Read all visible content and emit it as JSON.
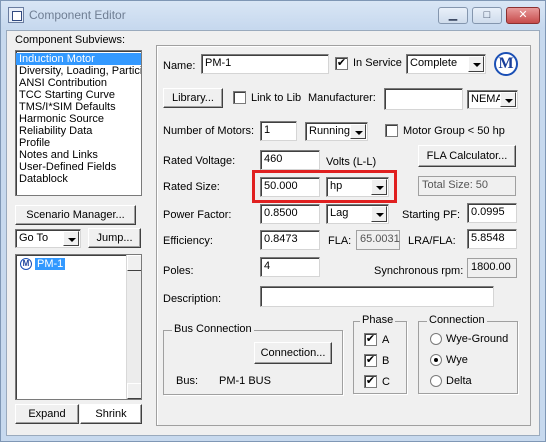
{
  "window": {
    "title": "Component Editor",
    "min_label": "▁",
    "max_label": "□",
    "close_label": "✕",
    "close_color": "#c74b4b"
  },
  "left": {
    "subviews_label": "Component Subviews:",
    "subviews": [
      "Induction Motor",
      "Diversity, Loading, Particip",
      "ANSI Contribution",
      "TCC Starting Curve",
      "TMS/I*SIM Defaults",
      "Harmonic Source",
      "Reliability Data",
      "Profile",
      "Notes and Links",
      "User-Defined Fields",
      "Datablock"
    ],
    "selected_subview": 0,
    "scenario_button": "Scenario Manager...",
    "goto_value": "Go To",
    "jump_button": "Jump...",
    "tree_item": "PM-1",
    "expand_button": "Expand",
    "shrink_button": "Shrink"
  },
  "form": {
    "name_label": "Name:",
    "name_value": "PM-1",
    "in_service_label": "In Service",
    "in_service_checked": "✔",
    "status_value": "Complete",
    "library_button": "Library...",
    "link_to_lib_label": "Link to Lib",
    "manufacturer_label": "Manufacturer:",
    "manufacturer_value": "",
    "standard_value": "NEMA",
    "num_motors_label": "Number of Motors:",
    "num_motors_value": "1",
    "running_value": "Running",
    "motor_group_label": "Motor Group < 50 hp",
    "rated_voltage_label": "Rated Voltage:",
    "rated_voltage_value": "460",
    "volts_unit": "Volts (L-L)",
    "fla_calc_button": "FLA Calculator...",
    "rated_size_label": "Rated Size:",
    "rated_size_value": "50.000",
    "rated_size_unit": "hp",
    "total_size": "Total Size: 50",
    "power_factor_label": "Power Factor:",
    "power_factor_value": "0.8500",
    "lag_value": "Lag",
    "starting_pf_label": "Starting PF:",
    "starting_pf_value": "0.0995",
    "efficiency_label": "Efficiency:",
    "efficiency_value": "0.8473",
    "fla_label": "FLA:",
    "fla_value": "65.0031",
    "lra_fla_label": "LRA/FLA:",
    "lra_fla_value": "5.8548",
    "poles_label": "Poles:",
    "poles_value": "4",
    "sync_rpm_label": "Synchronous rpm:",
    "sync_rpm_value": "1800.00",
    "description_label": "Description:",
    "description_value": "",
    "bus_group_title": "Bus Connection",
    "connection_button": "Connection...",
    "bus_label": "Bus:",
    "bus_value": "PM-1 BUS",
    "phase_title": "Phase",
    "phases": [
      "A",
      "B",
      "C"
    ],
    "phase_check": "✔",
    "connection_title": "Connection",
    "connections": [
      "Wye-Ground",
      "Wye",
      "Delta"
    ],
    "selected_connection": "Wye",
    "highlight_color": "#e02020"
  }
}
